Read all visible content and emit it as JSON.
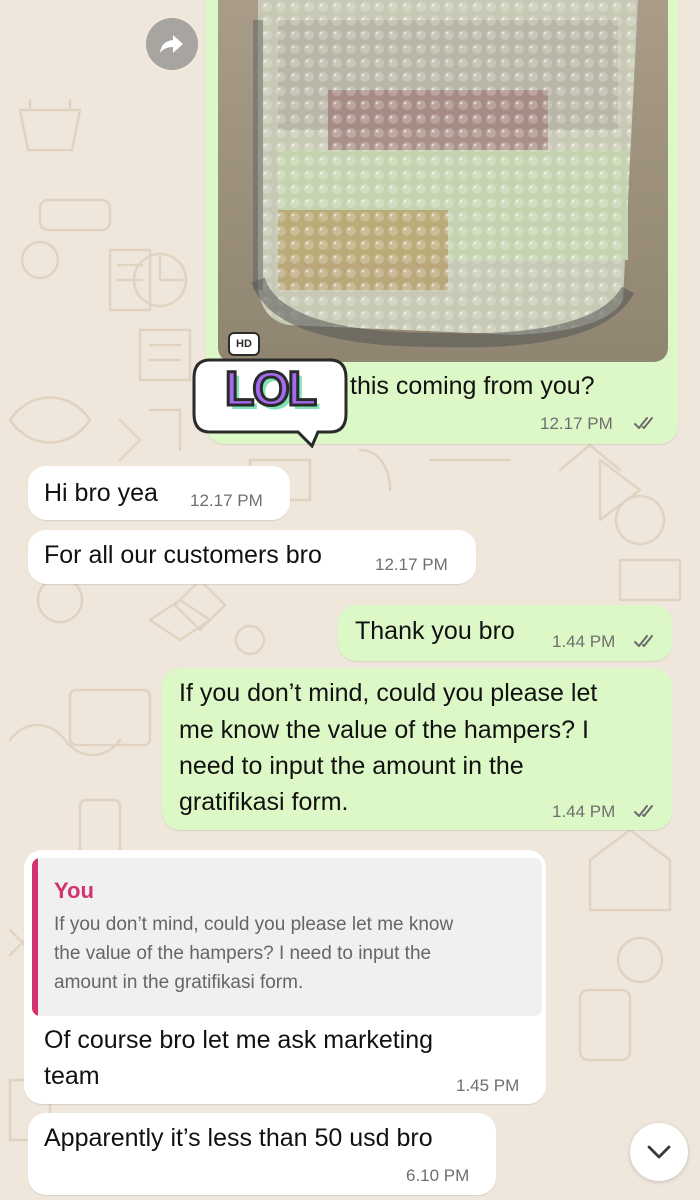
{
  "colors": {
    "outgoing_bubble": "#dcf8c6",
    "incoming_bubble": "#ffffff",
    "wallpaper": "#efe7dc",
    "read_ticks": "#6b6b6b",
    "quote_accent": "#d4326f"
  },
  "image_message": {
    "hd_badge": "HD",
    "sticker_text": "LOL",
    "caption": "this coming from you?",
    "time": "12.17 PM",
    "status_icon": "double-check-icon"
  },
  "messages": [
    {
      "direction": "incoming",
      "text": "Hi bro yea",
      "time": "12.17 PM"
    },
    {
      "direction": "incoming",
      "text": "For all our customers bro",
      "time": "12.17 PM"
    },
    {
      "direction": "outgoing",
      "text": "Thank you bro",
      "time": "1.44 PM",
      "status_icon": "double-check-icon"
    },
    {
      "direction": "outgoing",
      "lines": [
        "If you don’t mind, could you please let",
        "me know the value of the hampers? I",
        "need to input the amount in the",
        "gratifikasi form."
      ],
      "time": "1.44 PM",
      "status_icon": "double-check-icon"
    },
    {
      "direction": "incoming",
      "reply_to": {
        "author": "You",
        "lines": [
          "If you don’t mind, could you please let me know",
          "the value of the hampers? I need to input the",
          "amount in the gratifikasi form."
        ]
      },
      "lines": [
        "Of course bro let me ask marketing",
        "team"
      ],
      "time": "1.45 PM"
    },
    {
      "direction": "incoming",
      "text": "Apparently it’s less than 50 usd bro",
      "time": "6.10 PM"
    }
  ],
  "controls": {
    "forward_icon": "forward-arrow-icon",
    "scroll_down_icon": "chevron-down-icon"
  }
}
